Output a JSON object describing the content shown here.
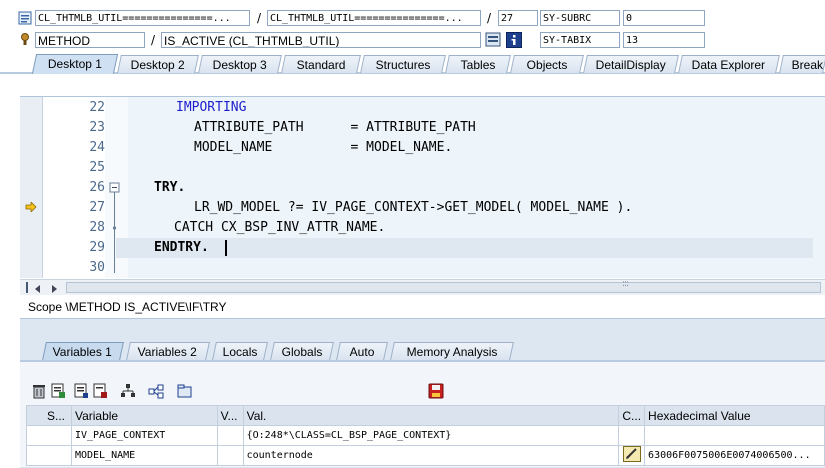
{
  "header": {
    "row1": {
      "program_field": "CL_THTMLB_UTIL===============...",
      "include_field": "CL_THTMLB_UTIL===============...",
      "line_field": "27",
      "sysvar_name": "SY-SUBRC",
      "sysvar_value": "0"
    },
    "row2": {
      "type_field": "METHOD",
      "method_field": "IS_ACTIVE (CL_THTMLB_UTIL)",
      "sysvar_name": "SY-TABIX",
      "sysvar_value": "13"
    },
    "separator": "/"
  },
  "tabs": [
    "Desktop 1",
    "Desktop 2",
    "Desktop 3",
    "Standard",
    "Structures",
    "Tables",
    "Objects",
    "DetailDisplay",
    "Data Explorer",
    "Break"
  ],
  "editor": {
    "lines": [
      {
        "num": "22",
        "text": "IMPORTING"
      },
      {
        "num": "23",
        "text": "ATTRIBUTE_PATH      = ATTRIBUTE_PATH"
      },
      {
        "num": "24",
        "text": "MODEL_NAME          = MODEL_NAME."
      },
      {
        "num": "25",
        "text": ""
      },
      {
        "num": "26",
        "text": "TRY."
      },
      {
        "num": "27",
        "text": "LR_WD_MODEL ?= IV_PAGE_CONTEXT->GET_MODEL( MODEL_NAME )."
      },
      {
        "num": "28",
        "text": "CATCH CX_BSP_INV_ATTR_NAME."
      },
      {
        "num": "29",
        "text": "ENDTRY."
      },
      {
        "num": "30",
        "text": ""
      }
    ],
    "scroll_grip": ":::"
  },
  "scope": "Scope \\METHOD IS_ACTIVE\\IF\\TRY",
  "variable_tabs": [
    "Variables 1",
    "Variables 2",
    "Locals",
    "Globals",
    "Auto",
    "Memory Analysis"
  ],
  "grid": {
    "headers": [
      "S...",
      "Variable",
      "V...",
      "Val.",
      "C...",
      "Hexadecimal Value"
    ],
    "rows": [
      {
        "variable": "IV_PAGE_CONTEXT",
        "value": "{O:248*\\CLASS=CL_BSP_PAGE_CONTEXT}",
        "hex": ""
      },
      {
        "variable": "MODEL_NAME",
        "value": "counternode",
        "hex": "63006F0075006E0074006500..."
      }
    ]
  },
  "colors": {
    "keyword": "#1e1ecc",
    "tab_bg": "#d9e3ef",
    "editor_bg": "#edf4fa",
    "current_line": "#dfe7f1",
    "line_number": "#4b6a8c"
  }
}
